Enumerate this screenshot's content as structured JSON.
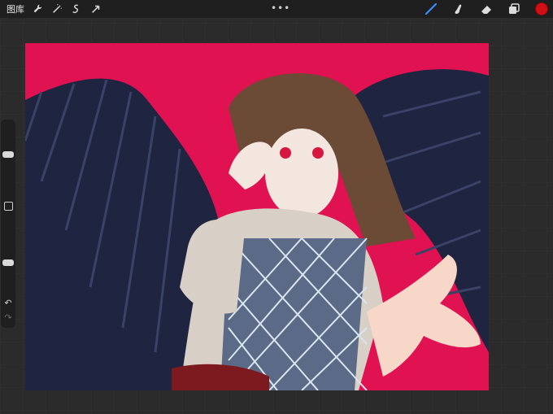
{
  "topbar": {
    "gallery_label": "图库",
    "more_label": "•••",
    "left_tools": [
      {
        "name": "wrench-icon"
      },
      {
        "name": "magic-wand-icon"
      },
      {
        "name": "selection-icon"
      },
      {
        "name": "transform-arrow-icon"
      }
    ],
    "right_tools": [
      {
        "name": "brush-icon",
        "active": true
      },
      {
        "name": "smudge-icon"
      },
      {
        "name": "eraser-icon"
      },
      {
        "name": "layers-icon"
      }
    ],
    "current_color": "#d30f16"
  },
  "sidebar": {
    "brush_size": 0.72,
    "brush_opacity": 0.28,
    "undo_icon": "undo-icon",
    "redo_icon": "redo-icon"
  },
  "canvas": {
    "background": "#e11252",
    "description_icons": "artwork"
  }
}
